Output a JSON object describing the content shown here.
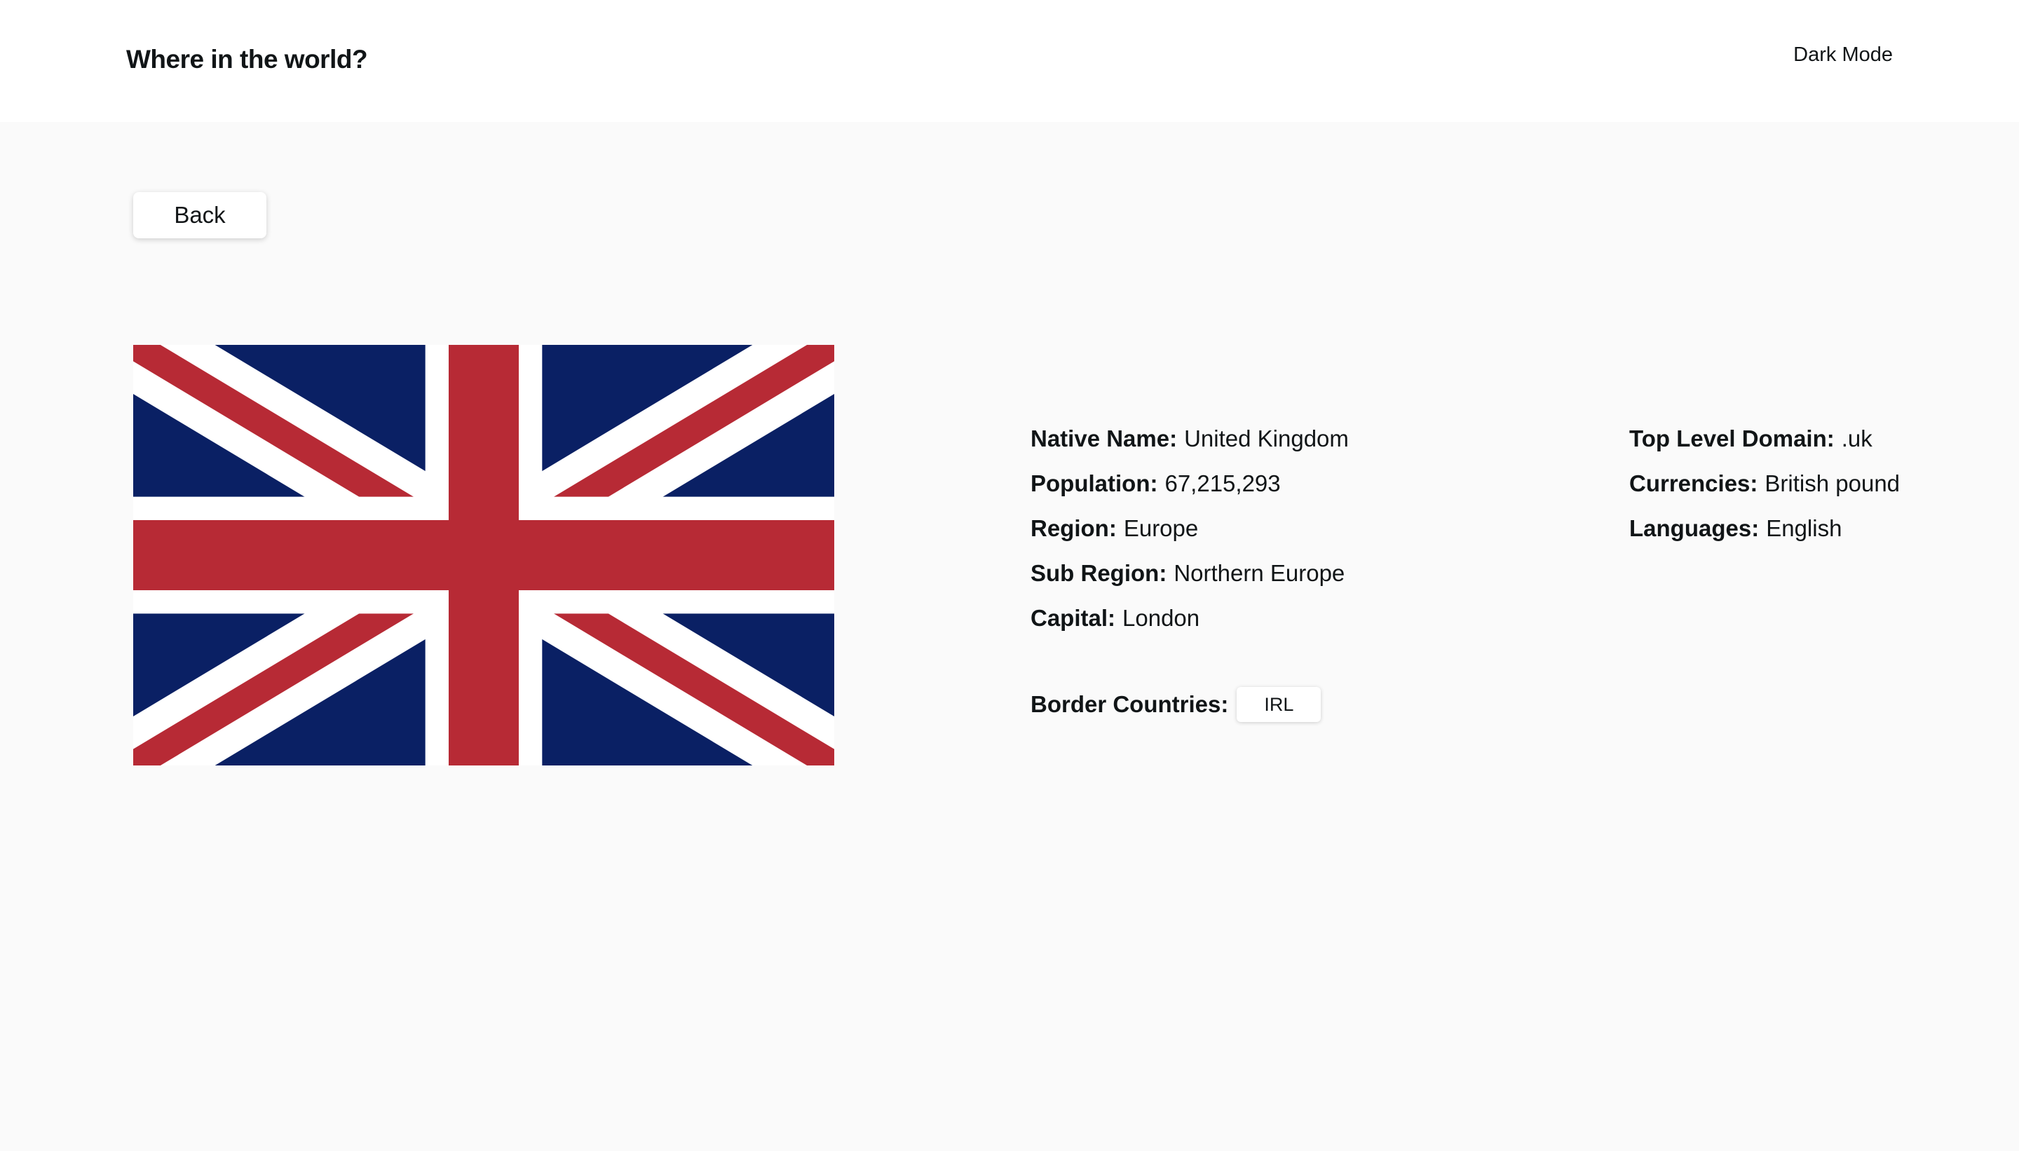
{
  "header": {
    "title": "Where in the world?",
    "theme_toggle_label": "Dark Mode"
  },
  "back_button_label": "Back",
  "flag": {
    "icon": "union-jack-flag",
    "colors": {
      "blue": "#0a2064",
      "red": "#b72a35",
      "white": "#ffffff"
    }
  },
  "details": {
    "native_name": {
      "label": "Native Name:",
      "value": "United Kingdom"
    },
    "population": {
      "label": "Population:",
      "value": "67,215,293"
    },
    "region": {
      "label": "Region:",
      "value": "Europe"
    },
    "sub_region": {
      "label": "Sub Region:",
      "value": "Northern Europe"
    },
    "capital": {
      "label": "Capital:",
      "value": "London"
    },
    "top_level_domain": {
      "label": "Top Level Domain:",
      "value": ".uk"
    },
    "currencies": {
      "label": "Currencies:",
      "value": "British pound"
    },
    "languages": {
      "label": "Languages:",
      "value": "English"
    }
  },
  "border_countries": {
    "label": "Border Countries:",
    "items": [
      "IRL"
    ]
  }
}
